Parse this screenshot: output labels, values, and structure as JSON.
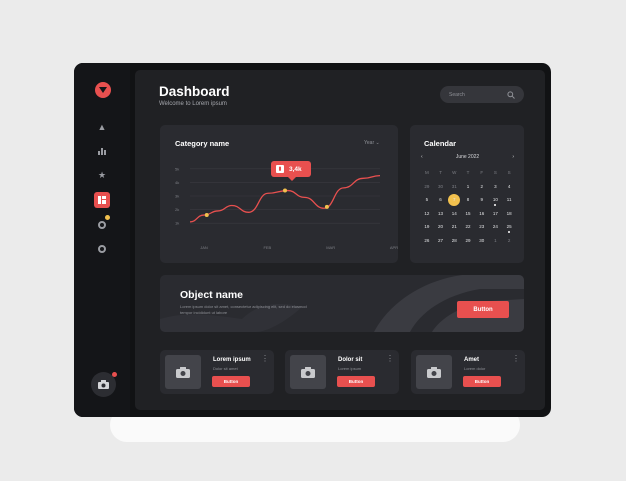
{
  "header": {
    "title": "Dashboard",
    "subtitle": "Welcome to Lorem ipsum",
    "search_placeholder": "Search"
  },
  "category_card": {
    "title": "Category name",
    "period_label": "Year",
    "tooltip_value": "3,4k"
  },
  "chart_data": {
    "type": "line",
    "x": [
      "JAN",
      "FEB",
      "MAR",
      "APR"
    ],
    "y_ticks": [
      "5k",
      "4k",
      "3k",
      "2k",
      "1k"
    ],
    "ylim": [
      0.5,
      5.5
    ],
    "series": [
      {
        "points": [
          [
            0,
            1.1
          ],
          [
            0.25,
            1.6
          ],
          [
            0.5,
            1.9
          ],
          [
            0.75,
            2.3
          ],
          [
            1.05,
            1.8
          ],
          [
            1.4,
            3.2
          ],
          [
            1.75,
            3.4
          ],
          [
            2.05,
            2.9
          ],
          [
            2.4,
            2.1
          ],
          [
            2.75,
            3.6
          ],
          [
            3.1,
            4.3
          ],
          [
            3.4,
            4.5
          ]
        ]
      }
    ],
    "markers": [
      [
        0.3,
        1.6
      ],
      [
        1.7,
        3.4
      ],
      [
        2.45,
        2.2
      ]
    ],
    "grid": true,
    "line_color": "#e8504f",
    "marker_color": "#f2c14e"
  },
  "calendar": {
    "title": "Calendar",
    "month": "June 2022",
    "weekdays": [
      "M",
      "T",
      "W",
      "T",
      "F",
      "S",
      "S"
    ],
    "days": [
      {
        "d": "29",
        "dim": true
      },
      {
        "d": "30",
        "dim": true
      },
      {
        "d": "31",
        "dim": true
      },
      {
        "d": "1"
      },
      {
        "d": "2"
      },
      {
        "d": "3"
      },
      {
        "d": "4"
      },
      {
        "d": "5"
      },
      {
        "d": "6"
      },
      {
        "d": "7",
        "sel": true
      },
      {
        "d": "8"
      },
      {
        "d": "9"
      },
      {
        "d": "10",
        "dot": true
      },
      {
        "d": "11"
      },
      {
        "d": "12"
      },
      {
        "d": "13"
      },
      {
        "d": "14"
      },
      {
        "d": "15"
      },
      {
        "d": "16"
      },
      {
        "d": "17"
      },
      {
        "d": "18"
      },
      {
        "d": "19"
      },
      {
        "d": "20"
      },
      {
        "d": "21"
      },
      {
        "d": "22"
      },
      {
        "d": "23"
      },
      {
        "d": "24"
      },
      {
        "d": "25",
        "dot": true
      },
      {
        "d": "26"
      },
      {
        "d": "27"
      },
      {
        "d": "28"
      },
      {
        "d": "29"
      },
      {
        "d": "30"
      },
      {
        "d": "1",
        "dim": true
      },
      {
        "d": "2",
        "dim": true
      }
    ]
  },
  "banner": {
    "title": "Object name",
    "text": "Lorem ipsum dolor sit amet, consectetur adipiscing elit, sed do eiusmod tempor incididunt ut labore",
    "button_label": "Button"
  },
  "items": [
    {
      "title": "Lorem ipsum",
      "subtitle": "Dolor sit amet",
      "button_label": "Button"
    },
    {
      "title": "Dolor sit",
      "subtitle": "Lorem ipsum",
      "button_label": "Button"
    },
    {
      "title": "Amet",
      "subtitle": "Lorem dolor",
      "button_label": "Button"
    }
  ],
  "icons": {
    "logo": "logo-icon",
    "nav": [
      "triangle-icon",
      "bar-chart-icon",
      "star-icon",
      "dashboard-icon",
      "circle-icon",
      "circle-icon"
    ],
    "camera": "camera-icon",
    "search": "search-icon"
  },
  "colors": {
    "accent": "#e8504f",
    "highlight": "#f2c14e",
    "card": "#2a2b30",
    "panel": "#202124"
  }
}
